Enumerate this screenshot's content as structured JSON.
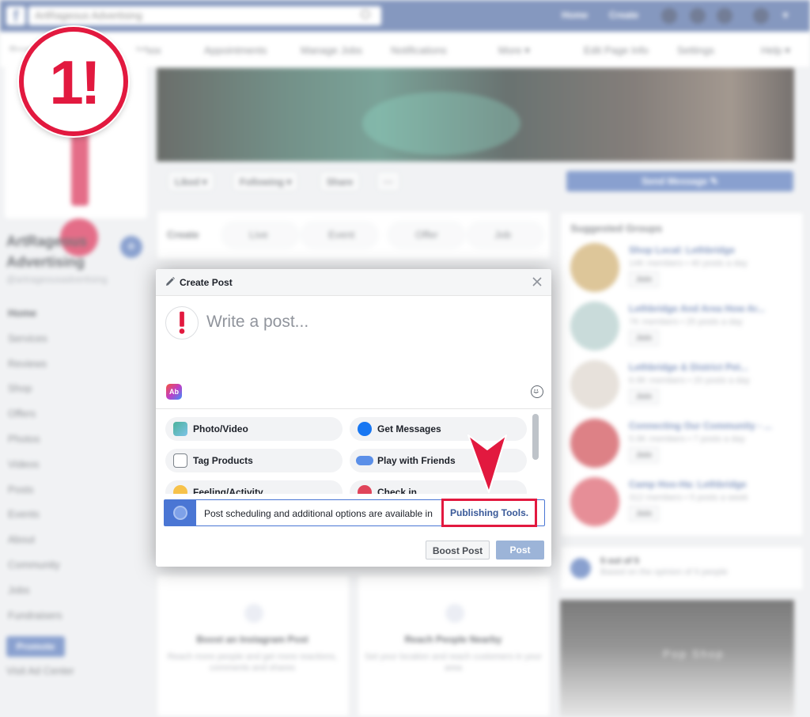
{
  "topbar": {
    "search_value": "ArtRageous Advertising",
    "nav_links": [
      "Home",
      "Create"
    ]
  },
  "page_tabs": [
    "Page",
    "Inbox",
    "Appointments",
    "Manage Jobs",
    "Notifications",
    "More ▾",
    "Edit Page Info",
    "Settings",
    "Help ▾"
  ],
  "page_actions": {
    "liked": "Liked ▾",
    "following": "Following ▾",
    "share": "Share",
    "more": "···",
    "send_message": "Send Message ✎"
  },
  "page_info": {
    "name": "ArtRageous Advertising",
    "handle": "@artrageousadvertising"
  },
  "left_nav": [
    "Home",
    "Services",
    "Reviews",
    "Shop",
    "Offers",
    "Photos",
    "Videos",
    "Posts",
    "Events",
    "About",
    "Community",
    "Jobs",
    "Fundraisers"
  ],
  "promote_label": "Promote",
  "ad_center_label": "Visit Ad Center",
  "create_bar": {
    "label": "Create",
    "items": [
      "Live",
      "Event",
      "Offer",
      "Job"
    ]
  },
  "suggested_groups": {
    "title": "Suggested Groups",
    "groups": [
      {
        "name": "Shop Local: Lethbridge",
        "meta": "14K members • 40 posts a day",
        "join": "Join",
        "color": "#c9a35b"
      },
      {
        "name": "Lethbridge And Area How Ar...",
        "meta": "7K members • 25 posts a day",
        "join": "Join",
        "color": "#a8c6c4"
      },
      {
        "name": "Lethbridge & District Pet...",
        "meta": "6.9K members • 20 posts a day",
        "join": "Join",
        "color": "#d8cfc5"
      },
      {
        "name": "Connecting Our Community - ...",
        "meta": "5.9K members • 7 posts a day",
        "join": "Join",
        "color": "#c8343d"
      },
      {
        "name": "Camp Hoo-Ha: Lethbridge",
        "meta": "312 members • 5 posts a week",
        "join": "Join",
        "color": "#d74a58"
      }
    ]
  },
  "rating_card": {
    "score": "5 out of 5",
    "text": "Based on the opinion of 9 people"
  },
  "promo_cards": [
    {
      "title": "Boost an Instagram Post",
      "desc": "Reach more people and get more reactions, comments and shares"
    },
    {
      "title": "Reach People Nearby",
      "desc": "Set your location and reach customers in your area"
    }
  ],
  "store_image_text": "Pop Shop",
  "badge_text": "1!",
  "modal": {
    "title": "Create Post",
    "placeholder": "Write a post...",
    "options": [
      {
        "label": "Photo/Video",
        "icon": "photo-video-icon",
        "color": "#4bb29b"
      },
      {
        "label": "Get Messages",
        "icon": "messenger-icon",
        "color": "#1877f2"
      },
      {
        "label": "Tag Products",
        "icon": "shopping-bag-icon",
        "color": "#7b8289"
      },
      {
        "label": "Play with Friends",
        "icon": "game-controller-icon",
        "color": "#5b8fe8"
      },
      {
        "label": "Feeling/Activity",
        "icon": "smiley-icon",
        "color": "#f7c24a"
      },
      {
        "label": "Check in",
        "icon": "location-pin-icon",
        "color": "#e0445a"
      }
    ],
    "notice_text": "Post scheduling and additional options are available in",
    "publishing_tools_link": "Publishing Tools.",
    "boost_button": "Boost Post",
    "post_button": "Post"
  },
  "colors": {
    "facebook_blue": "#3b5998",
    "highlight_red": "#e2193f",
    "link_blue": "#385898"
  }
}
